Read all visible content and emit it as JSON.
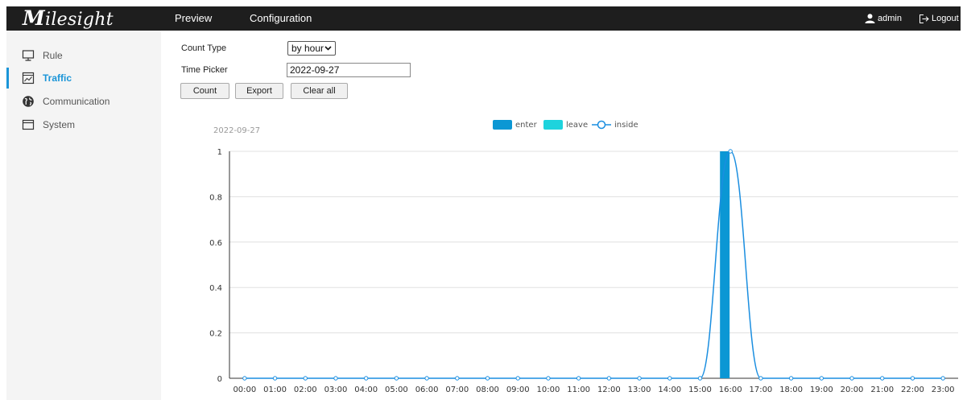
{
  "app": {
    "logo_text": "Milesight",
    "nav": [
      {
        "label": "Preview"
      },
      {
        "label": "Configuration"
      }
    ],
    "user": "admin",
    "logout": "Logout"
  },
  "sidebar": {
    "items": [
      {
        "label": "Rule",
        "icon": "monitor-icon",
        "active": false
      },
      {
        "label": "Traffic",
        "icon": "chart-icon",
        "active": true
      },
      {
        "label": "Communication",
        "icon": "globe-icon",
        "active": false
      },
      {
        "label": "System",
        "icon": "window-icon",
        "active": false
      }
    ]
  },
  "form": {
    "count_type_label": "Count Type",
    "count_type_value": "by hour",
    "time_picker_label": "Time Picker",
    "time_picker_value": "2022-09-27",
    "buttons": {
      "count": "Count",
      "export": "Export",
      "clear": "Clear all"
    }
  },
  "colors": {
    "accent": "#1a95d8",
    "enter": "#0b97d4",
    "leave": "#1ed3dd",
    "inside": "#1a8ee0"
  },
  "chart_data": {
    "type": "bar",
    "date_label": "2022-09-27",
    "categories": [
      "00:00",
      "01:00",
      "02:00",
      "03:00",
      "04:00",
      "05:00",
      "06:00",
      "07:00",
      "08:00",
      "09:00",
      "10:00",
      "11:00",
      "12:00",
      "13:00",
      "14:00",
      "15:00",
      "16:00",
      "17:00",
      "18:00",
      "19:00",
      "20:00",
      "21:00",
      "22:00",
      "23:00"
    ],
    "y_ticks": [
      "0",
      "0.2",
      "0.4",
      "0.6",
      "0.8",
      "1"
    ],
    "ylim": [
      0,
      1
    ],
    "legend_position": "top-center",
    "grid": "horizontal",
    "series": [
      {
        "name": "enter",
        "type": "bar",
        "values": [
          0,
          0,
          0,
          0,
          0,
          0,
          0,
          0,
          0,
          0,
          0,
          0,
          0,
          0,
          0,
          0,
          1,
          0,
          0,
          0,
          0,
          0,
          0,
          0
        ]
      },
      {
        "name": "leave",
        "type": "bar",
        "values": [
          0,
          0,
          0,
          0,
          0,
          0,
          0,
          0,
          0,
          0,
          0,
          0,
          0,
          0,
          0,
          0,
          0,
          0,
          0,
          0,
          0,
          0,
          0,
          0
        ]
      },
      {
        "name": "inside",
        "type": "line",
        "values": [
          0,
          0,
          0,
          0,
          0,
          0,
          0,
          0,
          0,
          0,
          0,
          0,
          0,
          0,
          0,
          0,
          1,
          0,
          0,
          0,
          0,
          0,
          0,
          0
        ]
      }
    ]
  }
}
